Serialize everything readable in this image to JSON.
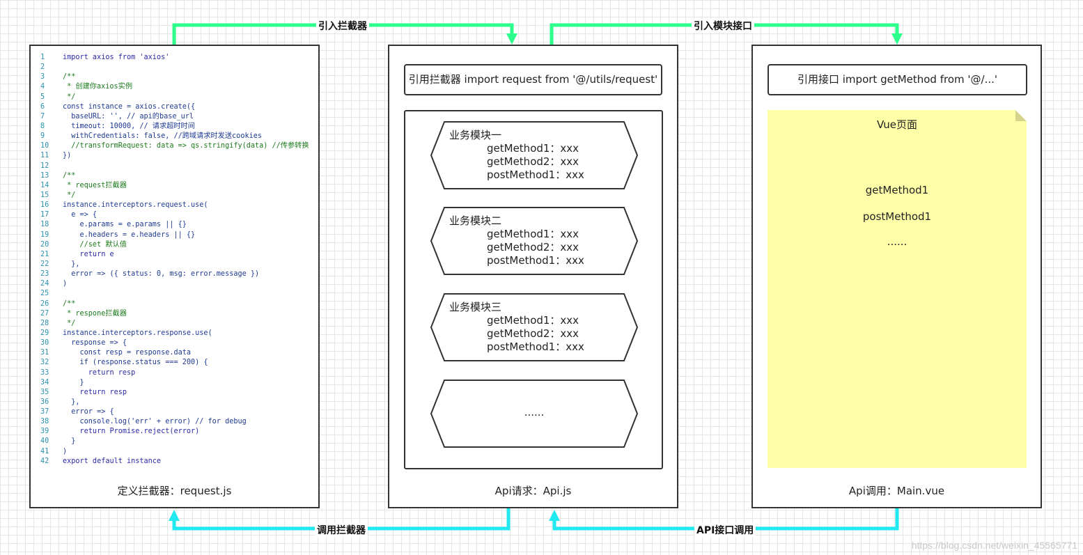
{
  "arrows": {
    "top_left_label": "引入拦截器",
    "top_right_label": "引入模块接口",
    "bottom_left_label": "调用拦截器",
    "bottom_right_label": "API接口调用",
    "top_color": "#2EFF8C",
    "bottom_color": "#21E9F0"
  },
  "panels": {
    "left": {
      "caption": "定义拦截器：request.js",
      "code_lines": [
        "import axios from 'axios'",
        "",
        "/**",
        " * 创建你axios实例",
        " */",
        "const instance = axios.create({",
        "  baseURL: '', // api的base_url",
        "  timeout: 10000, // 请求超时时间",
        "  withCredentials: false, //跨域请求时发送cookies",
        "  //transformRequest: data => qs.stringify(data) //传参转换",
        "})",
        "",
        "/**",
        " * request拦截器",
        " */",
        "instance.interceptors.request.use(",
        "  e => {",
        "    e.params = e.params || {}",
        "    e.headers = e.headers || {}",
        "    //set 默认值",
        "    return e",
        "  },",
        "  error => ({ status: 0, msg: error.message })",
        ")",
        "",
        "/**",
        " * respone拦截器",
        " */",
        "instance.interceptors.response.use(",
        "  response => {",
        "    const resp = response.data",
        "    if (response.status === 200) {",
        "      return resp",
        "    }",
        "    return resp",
        "  },",
        "  error => {",
        "    console.log('err' + error) // for debug",
        "    return Promise.reject(error)",
        "  }",
        ")",
        "export default instance"
      ]
    },
    "middle": {
      "caption": "Api请求：Api.js",
      "import_text": "引用拦截器 import request from '@/utils/request'",
      "modules": [
        {
          "title": "业务模块一",
          "methods": [
            "getMethod1：xxx",
            "getMethod2：xxx",
            "postMethod1：xxx"
          ]
        },
        {
          "title": "业务模块二",
          "methods": [
            "getMethod1：xxx",
            "getMethod2：xxx",
            "postMethod1：xxx"
          ]
        },
        {
          "title": "业务模块三",
          "methods": [
            "getMethod1：xxx",
            "getMethod2：xxx",
            "postMethod1：xxx"
          ]
        },
        {
          "title": "",
          "methods": [
            "......"
          ]
        }
      ]
    },
    "right": {
      "caption": "Api调用：Main.vue",
      "import_text": "引用接口 import  getMethod from '@/...'",
      "note_title": "Vue页面",
      "note_items": [
        "getMethod1",
        "postMethod1",
        "......"
      ]
    }
  },
  "watermark": "https://blog.csdn.net/weixin_45565771"
}
